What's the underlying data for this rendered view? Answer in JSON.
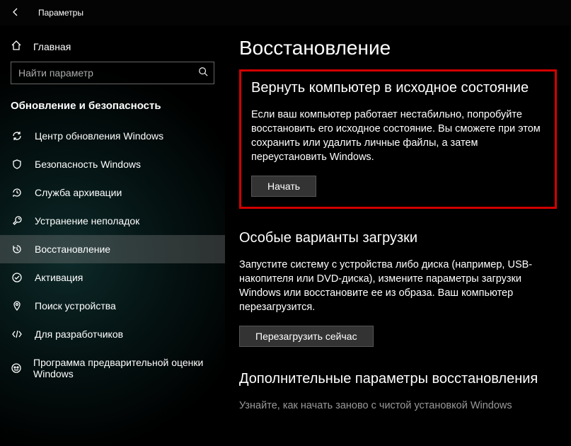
{
  "window": {
    "title": "Параметры"
  },
  "sidebar": {
    "home_label": "Главная",
    "search_placeholder": "Найти параметр",
    "section_title": "Обновление и безопасность",
    "items": [
      {
        "label": "Центр обновления Windows"
      },
      {
        "label": "Безопасность Windows"
      },
      {
        "label": "Служба архивации"
      },
      {
        "label": "Устранение неполадок"
      },
      {
        "label": "Восстановление"
      },
      {
        "label": "Активация"
      },
      {
        "label": "Поиск устройства"
      },
      {
        "label": "Для разработчиков"
      },
      {
        "label": "Программа предварительной оценки Windows"
      }
    ]
  },
  "content": {
    "page_title": "Восстановление",
    "reset": {
      "heading": "Вернуть компьютер в исходное состояние",
      "text": "Если ваш компьютер работает нестабильно, попробуйте восстановить его исходное состояние. Вы сможете при этом сохранить или удалить личные файлы, а затем переустановить Windows.",
      "button": "Начать"
    },
    "advanced": {
      "heading": "Особые варианты загрузки",
      "text": "Запустите систему с устройства либо диска (например, USB-накопителя или DVD-диска), измените параметры загрузки Windows или восстановите ее из образа. Ваш компьютер перезагрузится.",
      "button": "Перезагрузить сейчас"
    },
    "more": {
      "heading": "Дополнительные параметры восстановления",
      "text": "Узнайте, как начать заново с чистой установкой Windows"
    }
  }
}
